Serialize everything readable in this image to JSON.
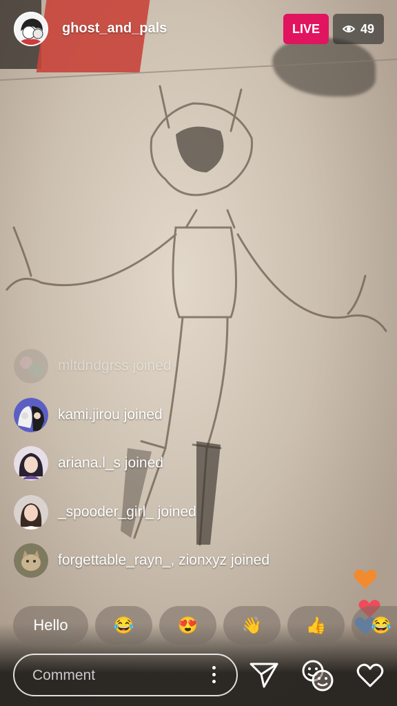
{
  "header": {
    "host_username": "ghost_and_pals",
    "live_label": "LIVE",
    "viewer_count": "49",
    "viewer_icon": "eye-icon"
  },
  "feed": [
    {
      "text": "mltdndgrss joined",
      "faded": true
    },
    {
      "text": "kami.jirou joined",
      "faded": false
    },
    {
      "text": "ariana.l_s joined",
      "faded": false
    },
    {
      "text": "_spooder_girl_ joined",
      "faded": false
    },
    {
      "text": "forgettable_rayn_, zionxyz joined",
      "faded": false
    }
  ],
  "quick_reactions": [
    {
      "label": "Hello"
    },
    {
      "label": "😂"
    },
    {
      "label": "😍"
    },
    {
      "label": "👋"
    },
    {
      "label": "👍"
    }
  ],
  "comment": {
    "placeholder": "Comment"
  },
  "floating_reactions": [
    {
      "icon": "heart-icon",
      "color": "#f28a2e"
    },
    {
      "icon": "heart-icon",
      "color": "#ef4b5a"
    },
    {
      "icon": "heart-icon",
      "color": "#4a90e2"
    }
  ],
  "colors": {
    "live_badge": "#e0145f",
    "text": "#ffffff"
  }
}
